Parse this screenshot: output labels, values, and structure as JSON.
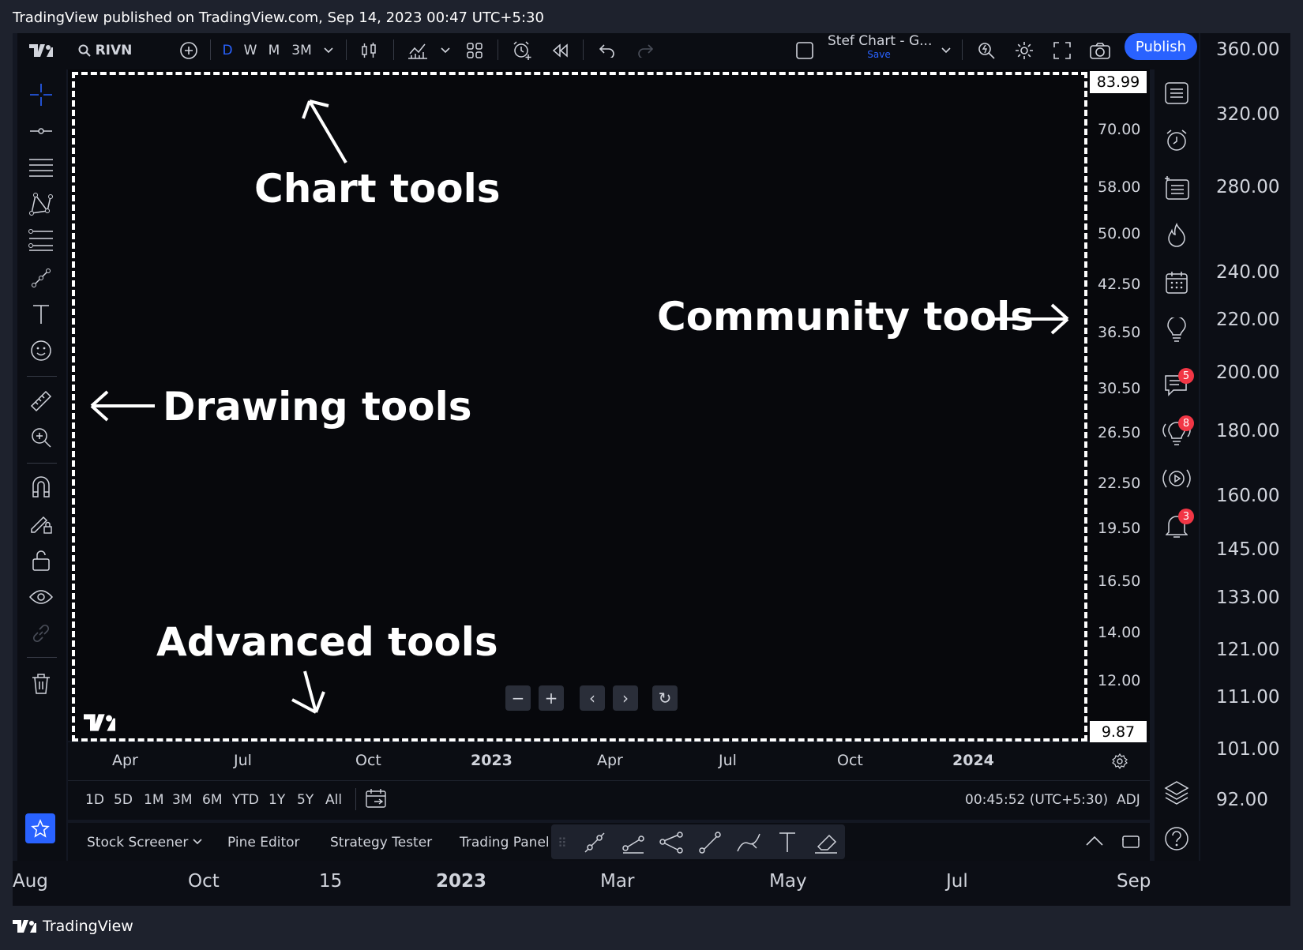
{
  "caption": "TradingView published on TradingView.com, Sep 14, 2023 00:47 UTC+5:30",
  "toolbar": {
    "symbol": "RIVN",
    "intervals": [
      "D",
      "W",
      "M",
      "3M"
    ],
    "layout_name": "Stef Chart - G...",
    "save_label": "Save",
    "publish_label": "Publish"
  },
  "annotations": {
    "chart_tools": "Chart tools",
    "community_tools": "Community tools",
    "drawing_tools": "Drawing tools",
    "advanced_tools": "Advanced tools"
  },
  "price_axis": {
    "top_box": "83.99",
    "bottom_box": "9.87",
    "labels": [
      "70.00",
      "58.00",
      "50.00",
      "42.50",
      "36.50",
      "30.50",
      "26.50",
      "22.50",
      "19.50",
      "16.50",
      "14.00",
      "12.00"
    ]
  },
  "time_axis": {
    "labels": [
      "Apr",
      "Jul",
      "Oct",
      "2023",
      "Apr",
      "Jul",
      "Oct",
      "2024"
    ]
  },
  "range_bar": {
    "ranges": [
      "1D",
      "5D",
      "1M",
      "3M",
      "6M",
      "YTD",
      "1Y",
      "5Y",
      "All"
    ],
    "clock": "00:45:52 (UTC+5:30)",
    "adj": "ADJ"
  },
  "bottom_panel": {
    "tabs": [
      "Stock Screener",
      "Pine Editor",
      "Strategy Tester",
      "Trading Panel"
    ]
  },
  "right_badges": {
    "chat": "5",
    "ideas": "8",
    "alerts": "3"
  },
  "outer_price_axis": [
    "360.00",
    "320.00",
    "280.00",
    "240.00",
    "220.00",
    "200.00",
    "180.00",
    "160.00",
    "145.00",
    "133.00",
    "121.00",
    "111.00",
    "101.00",
    "92.00"
  ],
  "outer_time_axis": [
    "Aug",
    "Oct",
    "15",
    "2023",
    "Mar",
    "May",
    "Jul",
    "Sep"
  ],
  "footer": "TradingView",
  "colors": {
    "accent": "#2962ff",
    "badge": "#f23645",
    "background": "#131722"
  }
}
